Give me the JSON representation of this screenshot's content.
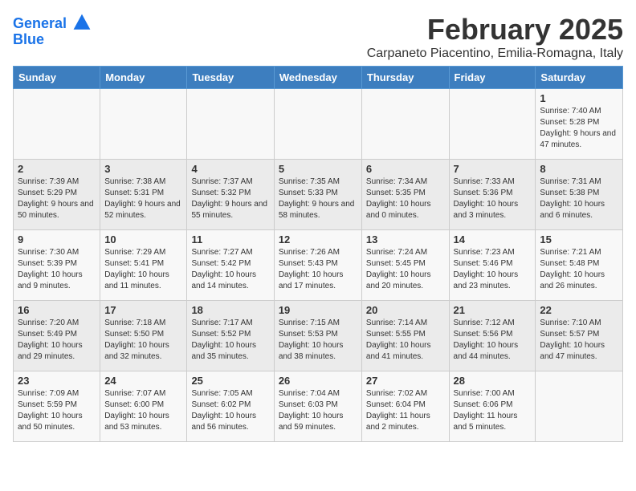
{
  "header": {
    "logo_line1": "General",
    "logo_line2": "Blue",
    "month": "February 2025",
    "location": "Carpaneto Piacentino, Emilia-Romagna, Italy"
  },
  "days_of_week": [
    "Sunday",
    "Monday",
    "Tuesday",
    "Wednesday",
    "Thursday",
    "Friday",
    "Saturday"
  ],
  "weeks": [
    [
      {
        "day": "",
        "info": ""
      },
      {
        "day": "",
        "info": ""
      },
      {
        "day": "",
        "info": ""
      },
      {
        "day": "",
        "info": ""
      },
      {
        "day": "",
        "info": ""
      },
      {
        "day": "",
        "info": ""
      },
      {
        "day": "1",
        "info": "Sunrise: 7:40 AM\nSunset: 5:28 PM\nDaylight: 9 hours and 47 minutes."
      }
    ],
    [
      {
        "day": "2",
        "info": "Sunrise: 7:39 AM\nSunset: 5:29 PM\nDaylight: 9 hours and 50 minutes."
      },
      {
        "day": "3",
        "info": "Sunrise: 7:38 AM\nSunset: 5:31 PM\nDaylight: 9 hours and 52 minutes."
      },
      {
        "day": "4",
        "info": "Sunrise: 7:37 AM\nSunset: 5:32 PM\nDaylight: 9 hours and 55 minutes."
      },
      {
        "day": "5",
        "info": "Sunrise: 7:35 AM\nSunset: 5:33 PM\nDaylight: 9 hours and 58 minutes."
      },
      {
        "day": "6",
        "info": "Sunrise: 7:34 AM\nSunset: 5:35 PM\nDaylight: 10 hours and 0 minutes."
      },
      {
        "day": "7",
        "info": "Sunrise: 7:33 AM\nSunset: 5:36 PM\nDaylight: 10 hours and 3 minutes."
      },
      {
        "day": "8",
        "info": "Sunrise: 7:31 AM\nSunset: 5:38 PM\nDaylight: 10 hours and 6 minutes."
      }
    ],
    [
      {
        "day": "9",
        "info": "Sunrise: 7:30 AM\nSunset: 5:39 PM\nDaylight: 10 hours and 9 minutes."
      },
      {
        "day": "10",
        "info": "Sunrise: 7:29 AM\nSunset: 5:41 PM\nDaylight: 10 hours and 11 minutes."
      },
      {
        "day": "11",
        "info": "Sunrise: 7:27 AM\nSunset: 5:42 PM\nDaylight: 10 hours and 14 minutes."
      },
      {
        "day": "12",
        "info": "Sunrise: 7:26 AM\nSunset: 5:43 PM\nDaylight: 10 hours and 17 minutes."
      },
      {
        "day": "13",
        "info": "Sunrise: 7:24 AM\nSunset: 5:45 PM\nDaylight: 10 hours and 20 minutes."
      },
      {
        "day": "14",
        "info": "Sunrise: 7:23 AM\nSunset: 5:46 PM\nDaylight: 10 hours and 23 minutes."
      },
      {
        "day": "15",
        "info": "Sunrise: 7:21 AM\nSunset: 5:48 PM\nDaylight: 10 hours and 26 minutes."
      }
    ],
    [
      {
        "day": "16",
        "info": "Sunrise: 7:20 AM\nSunset: 5:49 PM\nDaylight: 10 hours and 29 minutes."
      },
      {
        "day": "17",
        "info": "Sunrise: 7:18 AM\nSunset: 5:50 PM\nDaylight: 10 hours and 32 minutes."
      },
      {
        "day": "18",
        "info": "Sunrise: 7:17 AM\nSunset: 5:52 PM\nDaylight: 10 hours and 35 minutes."
      },
      {
        "day": "19",
        "info": "Sunrise: 7:15 AM\nSunset: 5:53 PM\nDaylight: 10 hours and 38 minutes."
      },
      {
        "day": "20",
        "info": "Sunrise: 7:14 AM\nSunset: 5:55 PM\nDaylight: 10 hours and 41 minutes."
      },
      {
        "day": "21",
        "info": "Sunrise: 7:12 AM\nSunset: 5:56 PM\nDaylight: 10 hours and 44 minutes."
      },
      {
        "day": "22",
        "info": "Sunrise: 7:10 AM\nSunset: 5:57 PM\nDaylight: 10 hours and 47 minutes."
      }
    ],
    [
      {
        "day": "23",
        "info": "Sunrise: 7:09 AM\nSunset: 5:59 PM\nDaylight: 10 hours and 50 minutes."
      },
      {
        "day": "24",
        "info": "Sunrise: 7:07 AM\nSunset: 6:00 PM\nDaylight: 10 hours and 53 minutes."
      },
      {
        "day": "25",
        "info": "Sunrise: 7:05 AM\nSunset: 6:02 PM\nDaylight: 10 hours and 56 minutes."
      },
      {
        "day": "26",
        "info": "Sunrise: 7:04 AM\nSunset: 6:03 PM\nDaylight: 10 hours and 59 minutes."
      },
      {
        "day": "27",
        "info": "Sunrise: 7:02 AM\nSunset: 6:04 PM\nDaylight: 11 hours and 2 minutes."
      },
      {
        "day": "28",
        "info": "Sunrise: 7:00 AM\nSunset: 6:06 PM\nDaylight: 11 hours and 5 minutes."
      },
      {
        "day": "",
        "info": ""
      }
    ]
  ]
}
